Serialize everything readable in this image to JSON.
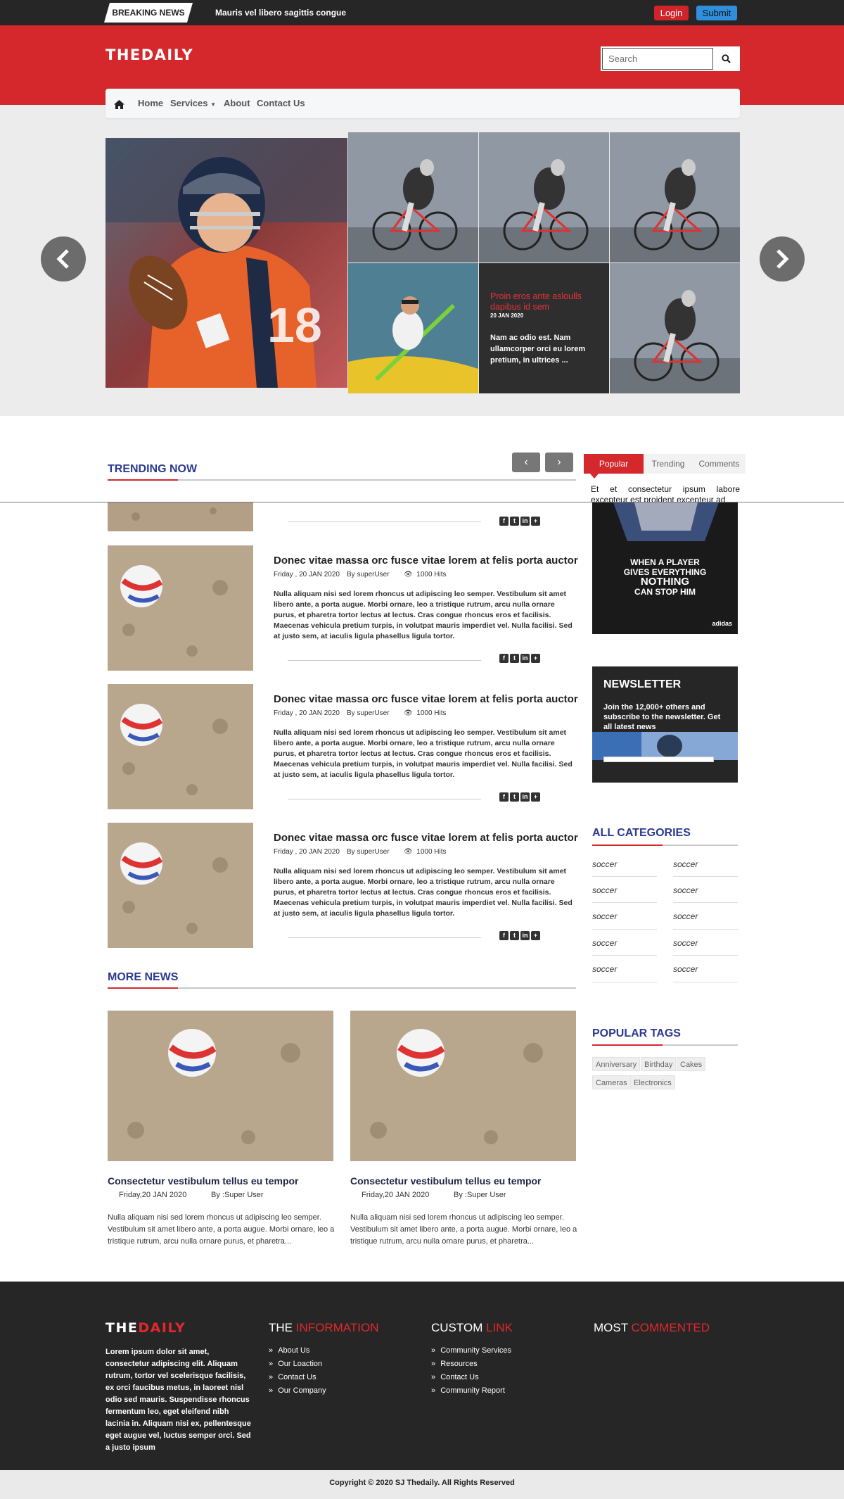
{
  "topbar": {
    "breaking_label": "BREAKING NEWS",
    "breaking_text": "Mauris vel libero sagittis congue",
    "login_label": "Login",
    "submit_label": "Submit"
  },
  "header": {
    "logo": "THEDAILY",
    "search_placeholder": "Search",
    "icons": {
      "search": "search-icon"
    }
  },
  "nav": {
    "items": [
      "Home",
      "Services",
      "About",
      "Contact Us"
    ],
    "icons": {
      "home": "home-icon",
      "services_caret": "caret-down-icon"
    }
  },
  "slider": {
    "overlay": {
      "title": "Proin eros ante asloulls dapibus id sem",
      "date": "20 JAN 2020",
      "text": "Nam ac odio est. Nam ullamcorper orci eu lorem pretium, in ultrices ..."
    },
    "icons": {
      "prev": "chevron-left-icon",
      "next": "chevron-right-icon"
    }
  },
  "trending": {
    "title": "TRENDING NOW",
    "pager": {
      "prev": "‹",
      "next": "›"
    },
    "articles": [
      {
        "title": "Donec vitae massa orc fusce vitae lorem at felis porta auctor",
        "date": "Friday , 20 JAN 2020",
        "author": "By superUser",
        "hits": "1000 Hits",
        "body": "Nulla aliquam nisi sed lorem rhoncus ut adipiscing leo semper. Vestibulum sit amet libero ante, a porta augue. Morbi ornare, leo a tristique rutrum, arcu nulla ornare purus, et pharetra tortor lectus at lectus. Cras congue rhoncus eros et facilisis. Maecenas vehicula pretium turpis, in volutpat mauris imperdiet vel. Nulla facilisi. Sed at justo sem, at iaculis ligula phasellus ligula tortor."
      },
      {
        "title": "Donec vitae massa orc fusce vitae lorem at felis porta auctor",
        "date": "Friday , 20 JAN 2020",
        "author": "By superUser",
        "hits": "1000 Hits",
        "body": "Nulla aliquam nisi sed lorem rhoncus ut adipiscing leo semper. Vestibulum sit amet libero ante, a porta augue. Morbi ornare, leo a tristique rutrum, arcu nulla ornare purus, et pharetra tortor lectus at lectus. Cras congue rhoncus eros et facilisis. Maecenas vehicula pretium turpis, in volutpat mauris imperdiet vel. Nulla facilisi. Sed at justo sem, at iaculis ligula phasellus ligula tortor."
      },
      {
        "title": "Donec vitae massa orc fusce vitae lorem at felis porta auctor",
        "date": "Friday , 20 JAN 2020",
        "author": "By superUser",
        "hits": "1000 Hits",
        "body": "Nulla aliquam nisi sed lorem rhoncus ut adipiscing leo semper. Vestibulum sit amet libero ante, a porta augue. Morbi ornare, leo a tristique rutrum, arcu nulla ornare purus, et pharetra tortor lectus at lectus. Cras congue rhoncus eros et facilisis. Maecenas vehicula pretium turpis, in volutpat mauris imperdiet vel. Nulla facilisi. Sed at justo sem, at iaculis ligula phasellus ligula tortor."
      }
    ],
    "share_icons": [
      "facebook-icon",
      "twitter-icon",
      "linkedin-icon",
      "plus-icon"
    ]
  },
  "sidebar": {
    "tabs": [
      "Popular",
      "Trending",
      "Comments"
    ],
    "tab_text": "Et et consectetur ipsum labore excepteur est proident excepteur ad",
    "ad_text": [
      "WHEN A PLAYER",
      "GIVES EVERYTHING",
      "NOTHING",
      "CAN STOP HIM"
    ],
    "ad_brand": "adidas",
    "newsletter": {
      "title": "NEWSLETTER",
      "text": "Join the 12,000+ others and subscribe to the newsletter. Get all latest news"
    },
    "categories_title": "ALL CATEGORIES",
    "categories": [
      "soccer",
      "soccer",
      "soccer",
      "soccer",
      "soccer",
      "soccer",
      "soccer",
      "soccer",
      "soccer",
      "soccer"
    ],
    "tags_title": "POPULAR TAGS",
    "tags": [
      "Anniversary",
      "Birthday",
      "Cakes",
      "Cameras",
      "Electronics"
    ]
  },
  "more_news": {
    "title": "MORE NEWS",
    "items": [
      {
        "title": "Consectetur vestibulum tellus eu tempor",
        "date": "Friday,20 JAN 2020",
        "author": "By :Super User",
        "body": "Nulla aliquam nisi sed lorem rhoncus ut adipiscing leo semper. Vestibulum sit amet libero ante, a porta augue. Morbi ornare, leo a tristique rutrum, arcu nulla ornare purus, et pharetra..."
      },
      {
        "title": "Consectetur vestibulum tellus eu tempor",
        "date": "Friday,20 JAN 2020",
        "author": "By :Super User",
        "body": "Nulla aliquam nisi sed lorem rhoncus ut adipiscing leo semper. Vestibulum sit amet libero ante, a porta augue. Morbi ornare, leo a tristique rutrum, arcu nulla ornare purus, et pharetra..."
      }
    ]
  },
  "footer": {
    "logo_a": "THE",
    "logo_b": "DAILY",
    "about": "Lorem ipsum dolor sit amet, consectetur adipiscing elit. Aliquam rutrum, tortor vel scelerisque facilisis, ex orci faucibus metus, in laoreet nisl odio sed mauris. Suspendisse rhoncus fermentum leo, eget eleifend nibh lacinia in. Aliquam nisi ex, pellentesque eget augue vel, luctus semper orci. Sed a justo ipsum",
    "col1": {
      "a": "THE ",
      "b": "INFORMATION",
      "links": [
        "About Us",
        "Our Loaction",
        "Contact Us",
        "Our Company"
      ]
    },
    "col2": {
      "a": "CUSTOM ",
      "b": "LINK",
      "links": [
        "Community Services",
        "Resources",
        "Contact Us",
        "Community Report"
      ]
    },
    "col3": {
      "a": "MOST ",
      "b": "COMMENTED"
    },
    "copyright": "Copyright © 2020 SJ Thedaily. All Rights Reserved"
  },
  "colors": {
    "accent": "#d4282d",
    "dark": "#262626",
    "navy": "#2b3990",
    "blue": "#2f8fdc"
  }
}
